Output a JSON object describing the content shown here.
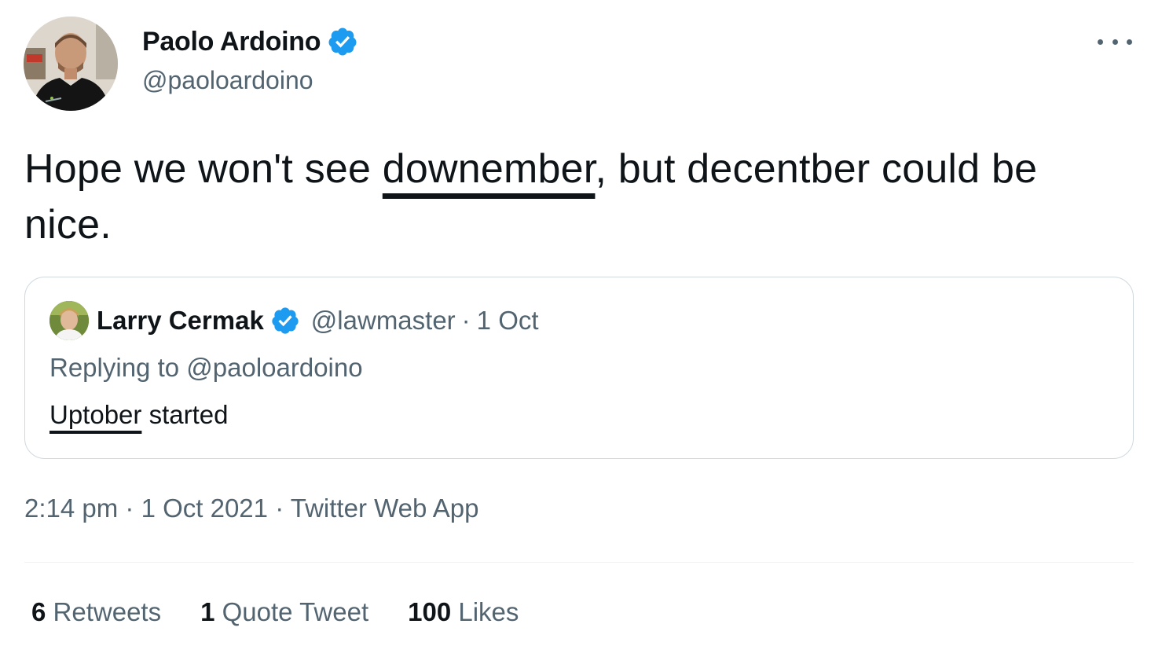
{
  "tweet": {
    "author": {
      "name": "Paolo Ardoino",
      "handle": "@paoloardoino",
      "verified": true,
      "avatar_icon": "profile-photo"
    },
    "more_icon": "more-horizontal-icon",
    "text_parts": {
      "before": "Hope we won't see ",
      "underlined": "downember",
      "after": ", but decentber could be nice."
    },
    "timestamp": "2:14 pm",
    "date": "1 Oct 2021",
    "separator": " · ",
    "source": "Twitter Web App",
    "stats": {
      "retweets_count": "6",
      "retweets_label": "Retweets",
      "quotes_count": "1",
      "quotes_label": "Quote Tweet",
      "likes_count": "100",
      "likes_label": "Likes"
    }
  },
  "quoted_tweet": {
    "author": {
      "name": "Larry Cermak",
      "handle": "@lawmaster",
      "verified": true
    },
    "separator": "·",
    "date": "1 Oct",
    "replying_label": "Replying to ",
    "replying_handle": "@paoloardoino",
    "text_parts": {
      "underlined": "Uptober",
      "after": " started"
    }
  },
  "colors": {
    "verified_blue": "#1d9bf0",
    "text_primary": "#0f1419",
    "text_secondary": "#536471",
    "border": "#cfd9de"
  }
}
